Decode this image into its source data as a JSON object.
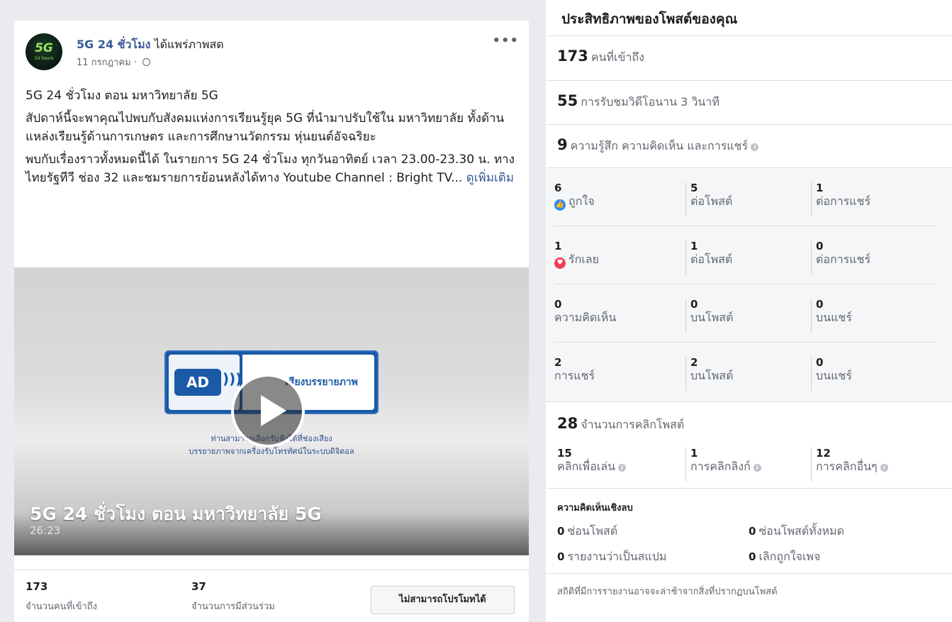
{
  "post": {
    "author": "5G 24 ชั่วโมง",
    "action": "ได้แพร่ภาพสด",
    "date": "11 กรกฎาคม · ",
    "avatar_text": "5G",
    "avatar_sub": "24 hours",
    "paragraph1": "5G 24 ชั่วโมง ตอน มหาวิทยาลัย 5G",
    "paragraph2": "สัปดาห์นี้จะพาคุณไปพบกับสังคมแห่งการเรียนรู้ยุค 5G ที่นำมาปรับใช้ใน มหาวิทยาลัย ทั้งด้านแหล่งเรียนรู้ด้านการเกษตร และการศึกษานวัตกรรม หุ่นยนต์อัจฉริยะ",
    "paragraph3": "พบกับเรื่องราวทั้งหมดนี้ได้ ในรายการ 5G 24 ชั่วโมง ทุกวันอาทิตย์ เวลา 23.00-23.30 น. ทางไทยรัฐทีวี ช่อง 32 และชมรายการย้อนหลังได้ทาง Youtube Channel : Bright TV... ",
    "see_more": "ดูเพิ่มเติม",
    "more_menu": "•••"
  },
  "video": {
    "ad_label": "AD",
    "ad_waves": ")))",
    "ad_caption": "เสียงบรรยายภาพ",
    "sub_line1": "ท่านสามารถเลือกรับฟังได้ที่ช่องเสียง",
    "sub_line2": "บรรยายภาพจากเครื่องรับโทรทัศน์ในระบบดิจิตอล",
    "title": "5G 24 ชั่วโมง ตอน มหาวิทยาลัย 5G",
    "duration": "26:23"
  },
  "post_stats": {
    "reach_value": "173",
    "reach_label": "จำนวนคนที่เข้าถึง",
    "engagement_value": "37",
    "engagement_label": "จำนวนการมีส่วนร่วม",
    "promote_button": "ไม่สามารถโปรโมทได้"
  },
  "insights": {
    "title": "ประสิทธิภาพของโพสต์ของคุณ",
    "reach": {
      "value": "173",
      "label": "คนที่เข้าถึง"
    },
    "views": {
      "value": "55",
      "label": "การรับชมวิดีโอนาน 3 วินาที"
    },
    "reactions": {
      "value": "9",
      "label": "ความรู้สึก ความคิดเห็น และการแชร์"
    },
    "grid": [
      {
        "main_value": "6",
        "main_label": "ถูกใจ",
        "post_value": "5",
        "post_label": "ต่อโพสต์",
        "share_value": "1",
        "share_label": "ต่อการแชร์"
      },
      {
        "main_value": "1",
        "main_label": "รักเลย",
        "post_value": "1",
        "post_label": "ต่อโพสต์",
        "share_value": "0",
        "share_label": "ต่อการแชร์"
      },
      {
        "main_value": "0",
        "main_label": "ความคิดเห็น",
        "post_value": "0",
        "post_label": "บนโพสต์",
        "share_value": "0",
        "share_label": "บนแชร์"
      },
      {
        "main_value": "2",
        "main_label": "การแชร์",
        "post_value": "2",
        "post_label": "บนโพสต์",
        "share_value": "0",
        "share_label": "บนแชร์"
      }
    ],
    "clicks": {
      "value": "28",
      "label": "จำนวนการคลิกโพสต์",
      "play_value": "15",
      "play_label": "คลิกเพื่อเล่น",
      "link_value": "1",
      "link_label": "การคลิกลิงก์",
      "other_value": "12",
      "other_label": "การคลิกอื่นๆ"
    },
    "negative": {
      "title": "ความคิดเห็นเชิงลบ",
      "hide_post_value": "0",
      "hide_post_label": "ซ่อนโพสต์",
      "hide_all_value": "0",
      "hide_all_label": "ซ่อนโพสต์ทั้งหมด",
      "spam_value": "0",
      "spam_label": "รายงานว่าเป็นสแปม",
      "unlike_value": "0",
      "unlike_label": "เลิกถูกใจเพจ"
    },
    "footnote": "สถิติที่มีการรายงานอาจจะล่าช้าจากสิ่งที่ปรากฏบนโพสต์",
    "info_glyph": "i",
    "like_glyph": "👍",
    "love_glyph": "♥"
  }
}
